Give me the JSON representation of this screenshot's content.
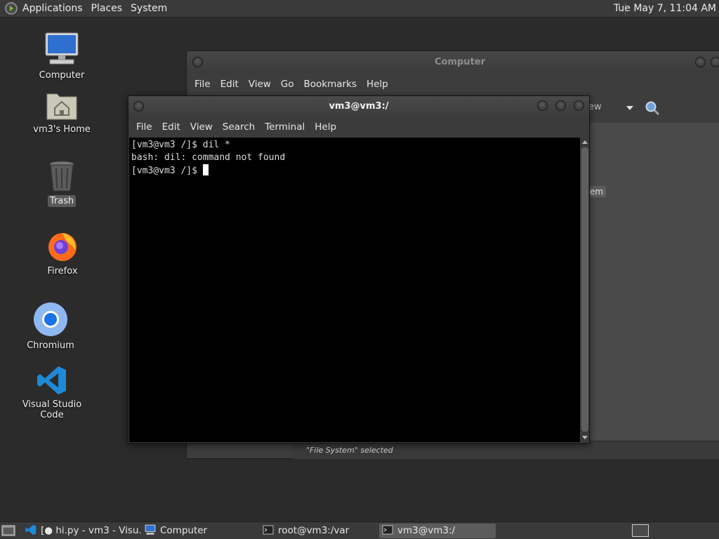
{
  "top_panel": {
    "menus": [
      "Applications",
      "Places",
      "System"
    ],
    "clock": "Tue May  7, 11:04 AM"
  },
  "desktop_icons": [
    {
      "label": "Computer",
      "icon": "computer-icon"
    },
    {
      "label": "vm3's Home",
      "icon": "home-folder-icon"
    },
    {
      "label": "Trash",
      "icon": "trash-icon"
    },
    {
      "label": "Firefox",
      "icon": "firefox-icon"
    },
    {
      "label": "Chromium",
      "icon": "chromium-icon"
    },
    {
      "label": "Visual Studio Code",
      "icon": "vscode-icon"
    }
  ],
  "computer_window": {
    "title": "Computer",
    "menus": [
      "File",
      "Edit",
      "View",
      "Go",
      "Bookmarks",
      "Help"
    ],
    "view_label": "ew",
    "side_badge": "em",
    "status": "\"File System\" selected"
  },
  "terminal_window": {
    "title": "vm3@vm3:/",
    "menus": [
      "File",
      "Edit",
      "View",
      "Search",
      "Terminal",
      "Help"
    ],
    "lines": [
      "[vm3@vm3 /]$ dil *",
      "bash: dil: command not found",
      "[vm3@vm3 /]$ "
    ]
  },
  "taskbar": {
    "tasks": [
      {
        "label": "[● hi.py - vm3 - Visu...",
        "icon": "vscode-icon",
        "active": false
      },
      {
        "label": "Computer",
        "icon": "computer-icon",
        "active": false
      },
      {
        "label": "root@vm3:/var",
        "icon": "terminal-icon",
        "active": false
      },
      {
        "label": "vm3@vm3:/",
        "icon": "terminal-icon",
        "active": true
      }
    ]
  },
  "colors": {
    "desktop_bg": "#2b2b2b",
    "panel_bg": "#3a3a3a",
    "terminal_bg": "#000000",
    "terminal_fg": "#dcdcdc"
  }
}
